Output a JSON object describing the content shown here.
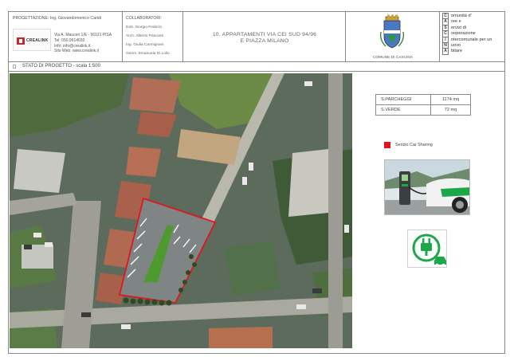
{
  "header": {
    "progettazione": "PROGETTAZIONE: Ing. Giovandomenico Caridi",
    "logo_text": "CREALINK",
    "address_lines": [
      "Via A. Mauceri 1/E - 56121 PISA",
      "Tel:    050.9914030",
      "Info:   info@crealink.it",
      "Sito Web:     www.crealink.it"
    ],
    "collaboratori_title": "COLLABORATORI:",
    "collaboratori": [
      "Dott. Giorgio Federici",
      "Arch. Alberto Pasciutti",
      "Ing. Giulia Carmignani",
      "Geom. Emanuela Di Lollo"
    ],
    "title_line1": "10. APPARTAMENTI VIA CEI SUD 94/96",
    "title_line2": "E PIAZZA MILANO",
    "comune": "COMUNE DI CASCINA",
    "cascina_letters": [
      "C",
      "A",
      "S",
      "C",
      "I",
      "N",
      "A"
    ],
    "cascina_words": [
      "omunità d'",
      "ree e",
      "ervizi di",
      "ooperazione",
      "ntercomunale per un",
      "uovo",
      "bitare"
    ]
  },
  "subheader": {
    "label": "STATO DI PROGETTO - scala 1:500"
  },
  "legend": {
    "rows": [
      {
        "label": "S.PARCHEGGI",
        "value": "1174 mq"
      },
      {
        "label": "S.VERDE",
        "value": "72 mq"
      }
    ],
    "car_sharing_label": "Serizio Car Sharing",
    "car_sharing_color": "#e0161e"
  },
  "colors": {
    "border": "#8a8a8a",
    "accent_red": "#e0161e",
    "ev_green": "#1aa84a"
  },
  "icons": [
    "crealink-logo",
    "cascina-crest-icon",
    "ev-charging-photo",
    "electric-car-icon"
  ]
}
